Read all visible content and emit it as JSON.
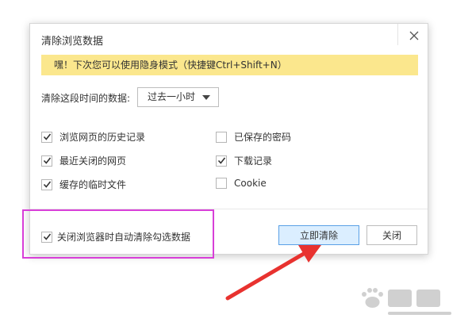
{
  "dialog": {
    "title": "清除浏览数据",
    "notice": "嘿！下次您可以使用隐身模式（快捷键Ctrl+Shift+N）",
    "time_label": "清除这段时间的数据:",
    "time_select_value": "过去一小时",
    "options": [
      {
        "label": "浏览网页的历史记录",
        "checked": true
      },
      {
        "label": "已保存的密码",
        "checked": false
      },
      {
        "label": "最近关闭的网页",
        "checked": true
      },
      {
        "label": "下载记录",
        "checked": true
      },
      {
        "label": "缓存的临时文件",
        "checked": true
      },
      {
        "label": "Cookie",
        "checked": false
      }
    ],
    "auto_clear": {
      "label": "关闭浏览器时自动清除勾选数据",
      "checked": true
    },
    "clear_button": "立即清除",
    "close_button": "关闭"
  },
  "colors": {
    "notice_bg": "#fbe78d",
    "primary_button_bg": "#dbeeff",
    "primary_button_border": "#5aa0e6",
    "annotation_box": "#d83fd8",
    "annotation_arrow": "#e8322f"
  },
  "icons": {
    "close": "close-icon",
    "checkbox_mark": "checkmark-icon",
    "dropdown": "caret-down-icon"
  }
}
